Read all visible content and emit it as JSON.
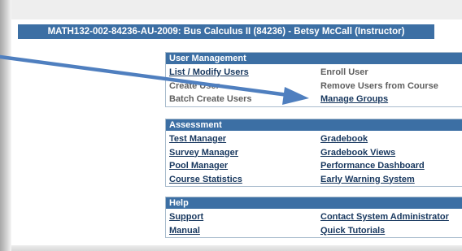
{
  "course": {
    "title": "MATH132-002-84236-AU-2009: Bus Calculus II (84236) - Betsy McCall (Instructor)"
  },
  "panels": {
    "user_management": {
      "title": "User Management",
      "rows": [
        {
          "left": "List / Modify Users",
          "right": "Enroll User"
        },
        {
          "left": "Create User",
          "right": "Remove Users from Course"
        },
        {
          "left": "Batch Create Users",
          "right": "Manage Groups"
        }
      ]
    },
    "assessment": {
      "title": "Assessment",
      "rows": [
        {
          "left": "Test Manager",
          "right": "Gradebook"
        },
        {
          "left": "Survey Manager",
          "right": "Gradebook Views"
        },
        {
          "left": "Pool Manager",
          "right": "Performance Dashboard"
        },
        {
          "left": "Course Statistics",
          "right": "Early Warning System"
        }
      ]
    },
    "help": {
      "title": "Help",
      "rows": [
        {
          "left": "Support",
          "right": "Contact System Administrator"
        },
        {
          "left": "Manual",
          "right": "Quick Tutorials"
        }
      ]
    }
  },
  "colors": {
    "header_bg": "#3c6fa4",
    "link": "#17375e",
    "static_text": "#5f5f5f",
    "annotation_arrow": "#4f7fbf"
  }
}
